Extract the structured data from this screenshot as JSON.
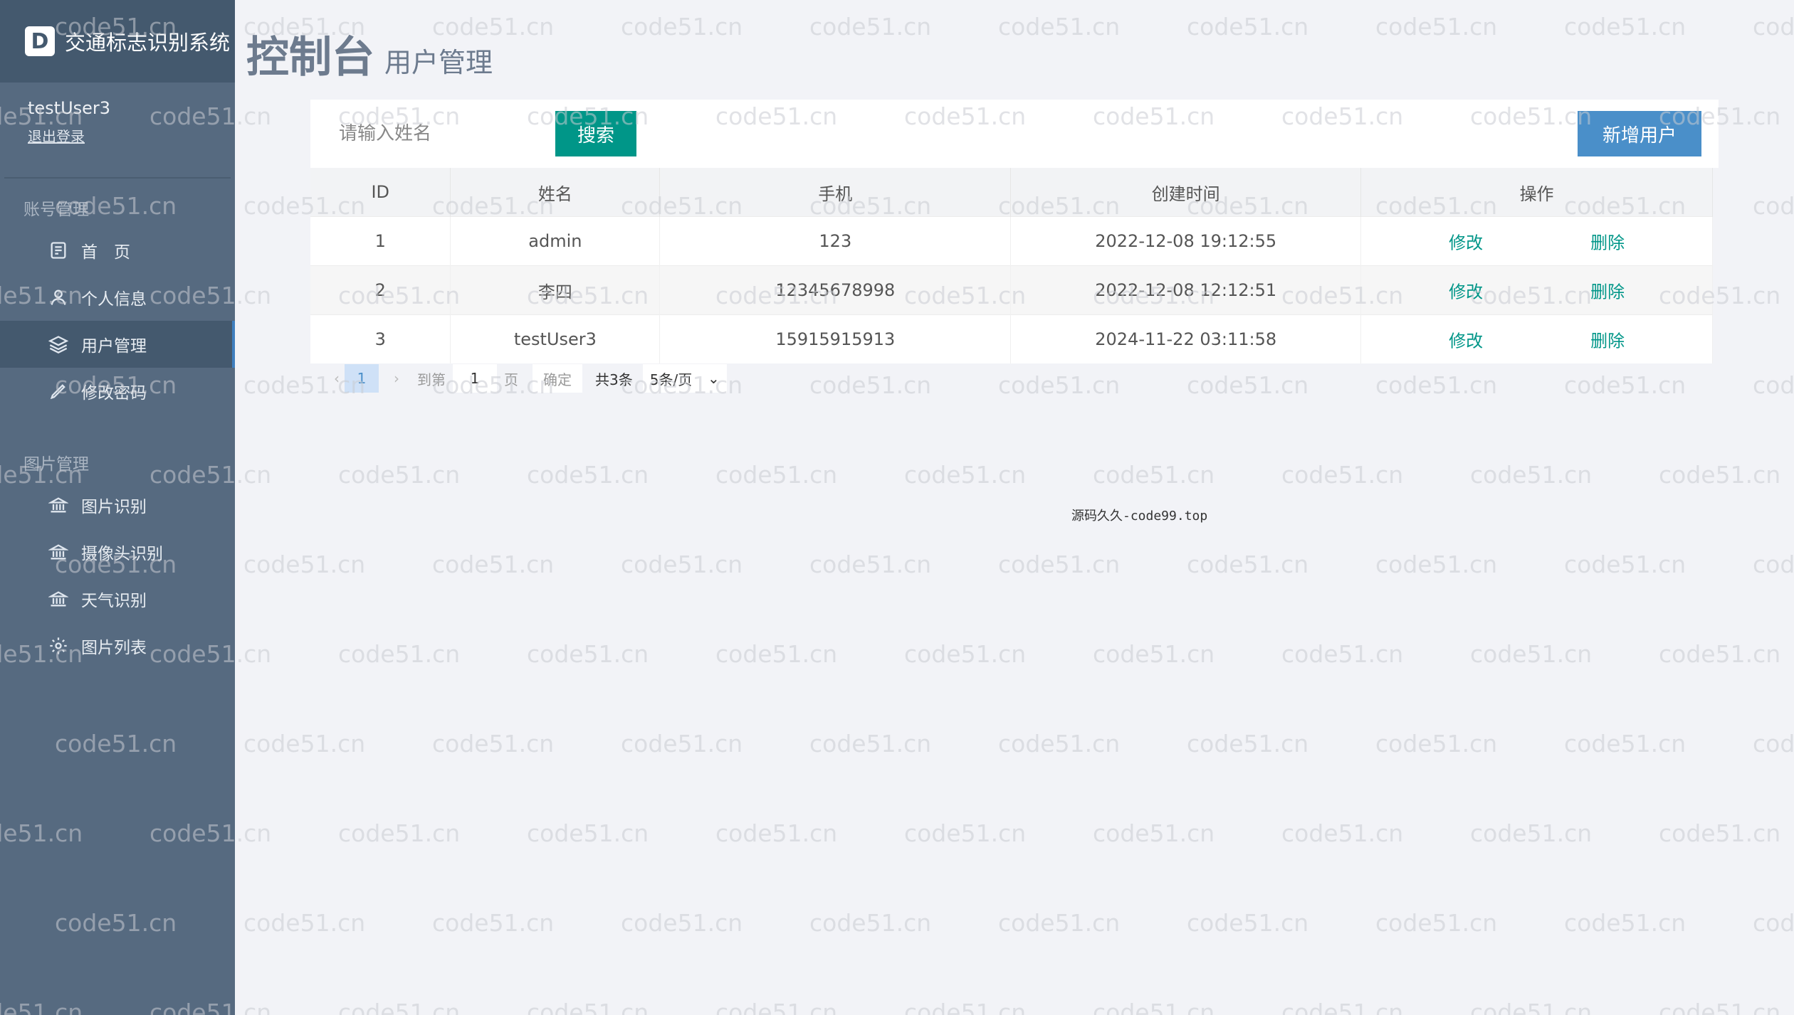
{
  "app": {
    "title": "交通标志识别系统",
    "logo_letter": "D"
  },
  "user": {
    "name": "testUser3",
    "logout_label": "退出登录"
  },
  "sidebar": {
    "groups": [
      {
        "title": "账号管理",
        "items": [
          {
            "label": "首　页",
            "icon": "home-doc-icon"
          },
          {
            "label": "个人信息",
            "icon": "user-icon"
          },
          {
            "label": "用户管理",
            "icon": "layers-icon",
            "active": true
          },
          {
            "label": "修改密码",
            "icon": "pen-icon"
          }
        ]
      },
      {
        "title": "图片管理",
        "items": [
          {
            "label": "图片识别",
            "icon": "bank-icon"
          },
          {
            "label": "摄像头识别",
            "icon": "bank-icon"
          },
          {
            "label": "天气识别",
            "icon": "bank-icon"
          },
          {
            "label": "图片列表",
            "icon": "gear-icon"
          }
        ]
      }
    ]
  },
  "header": {
    "title": "控制台",
    "subtitle": "用户管理"
  },
  "toolbar": {
    "search_placeholder": "请输入姓名",
    "search_label": "搜索",
    "add_label": "新增用户"
  },
  "table": {
    "columns": [
      "ID",
      "姓名",
      "手机",
      "创建时间",
      "操作"
    ],
    "rows": [
      {
        "id": "1",
        "name": "admin",
        "phone": "123",
        "created": "2022-12-08 19:12:55",
        "edit": "修改",
        "delete": "删除"
      },
      {
        "id": "2",
        "name": "李四",
        "phone": "12345678998",
        "created": "2022-12-08 12:12:51",
        "edit": "修改",
        "delete": "删除"
      },
      {
        "id": "3",
        "name": "testUser3",
        "phone": "15915915913",
        "created": "2024-11-22 03:11:58",
        "edit": "修改",
        "delete": "删除"
      }
    ]
  },
  "pagination": {
    "current_page": "1",
    "goto_label": "到第",
    "goto_value": "1",
    "page_unit": "页",
    "confirm_label": "确定",
    "total_label": "共3条",
    "page_size_label": "5条/页"
  },
  "footer": {
    "text": "源码久久-code99.top"
  },
  "watermark": {
    "text": "code51.cn"
  },
  "colors": {
    "sidebar": "#566a80",
    "brand_bar": "#44596e",
    "primary": "#009688",
    "accent": "#4a8fc9"
  }
}
